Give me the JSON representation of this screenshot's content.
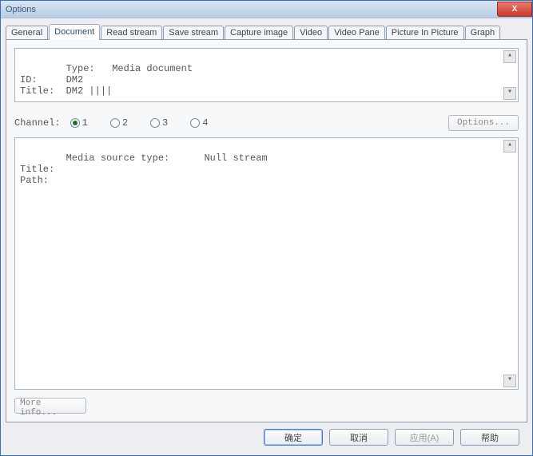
{
  "window": {
    "title": "Options",
    "close_glyph": "X"
  },
  "tabs": [
    {
      "label": "General",
      "active": false
    },
    {
      "label": "Document",
      "active": true
    },
    {
      "label": "Read stream",
      "active": false
    },
    {
      "label": "Save stream",
      "active": false
    },
    {
      "label": "Capture image",
      "active": false
    },
    {
      "label": "Video",
      "active": false
    },
    {
      "label": "Video Pane",
      "active": false
    },
    {
      "label": "Picture In Picture",
      "active": false
    },
    {
      "label": "Graph",
      "active": false
    }
  ],
  "overflow_left": "◄",
  "overflow_right": "►",
  "doc_info": {
    "text": "Type:   Media document\nID:     DM2\nTitle:  DM2 ||||"
  },
  "channel": {
    "label": "Channel:",
    "options": [
      "1",
      "2",
      "3",
      "4"
    ],
    "selected": "1",
    "options_button": "Options..."
  },
  "stream_info": {
    "text": "Media source type:      Null stream\nTitle:\nPath:"
  },
  "more_info_button": "More info...",
  "buttons": {
    "ok": "确定",
    "cancel": "取消",
    "apply": "应用(A)",
    "help": "帮助"
  }
}
